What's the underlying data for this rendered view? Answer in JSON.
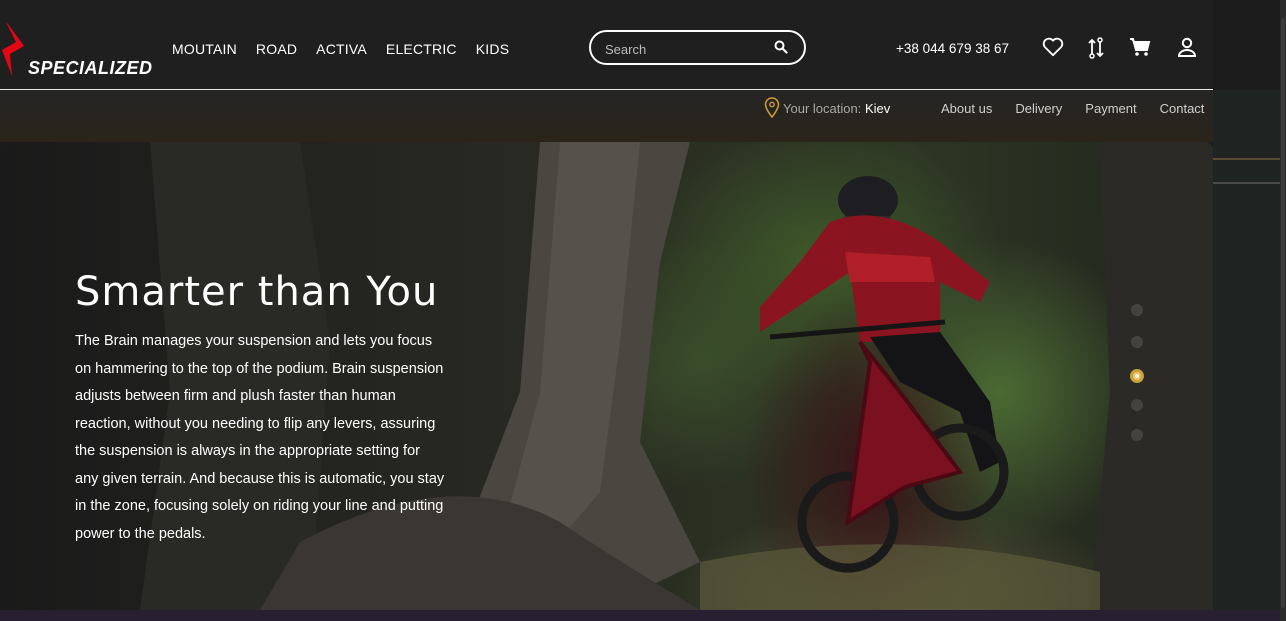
{
  "brand": {
    "name": "SPECIALIZED",
    "accent": "#e30613"
  },
  "nav": {
    "items": [
      "MOUTAIN",
      "ROAD",
      "ACTIVA",
      "ELECTRIC",
      "KIDS"
    ]
  },
  "search": {
    "placeholder": "Search",
    "value": ""
  },
  "contact": {
    "phone": "+38 044 679 38 67"
  },
  "header_icons": [
    "heart-icon",
    "compare-icon",
    "cart-icon",
    "user-icon"
  ],
  "subbar": {
    "location_label": "Your location:",
    "location_city": "Kiev",
    "links": [
      "About us",
      "Delivery",
      "Payment",
      "Contact"
    ]
  },
  "hero": {
    "title": "Smarter than You",
    "text": "The Brain manages your suspension and lets you focus on hammering to the top of the podium. Brain suspension adjusts between firm and plush faster than human reaction, without you needing to flip any levers, assuring the suspension is always in the appropriate setting for any given terrain. And because this is automatic, you stay in the zone, focusing solely on riding your line and putting power to the pedals.",
    "slides_count": 5,
    "active_slide": 3,
    "active_color": "#e9c46a"
  }
}
